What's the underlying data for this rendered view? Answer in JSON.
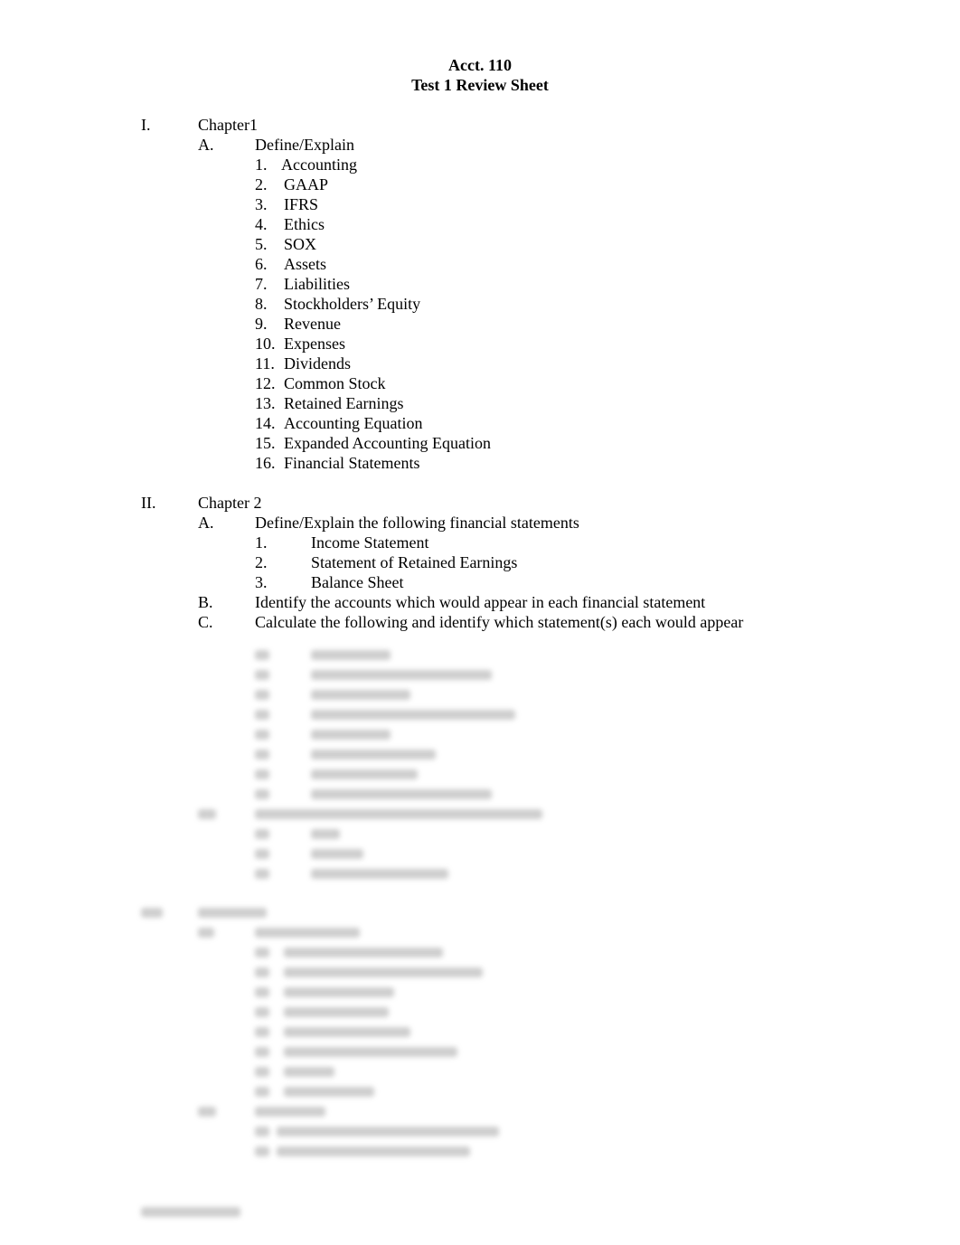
{
  "header": {
    "course": "Acct. 110",
    "title": "Test 1 Review Sheet"
  },
  "sections": [
    {
      "numeral": "I.",
      "heading": "Chapter1",
      "subsections": [
        {
          "letter": "A.",
          "text": "Define/Explain",
          "items": [
            "Accounting",
            "GAAP",
            "IFRS",
            "Ethics",
            "SOX",
            "Assets",
            "Liabilities",
            "Stockholders’ Equity",
            "Revenue",
            "Expenses",
            "Dividends",
            "Common Stock",
            "Retained Earnings",
            "Accounting Equation",
            "Expanded Accounting Equation",
            "Financial Statements"
          ]
        }
      ]
    },
    {
      "numeral": "II.",
      "heading": "Chapter 2",
      "subsections": [
        {
          "letter": "A.",
          "text": "Define/Explain the following financial statements",
          "items": [
            "Income Statement",
            "Statement of Retained Earnings",
            "Balance Sheet"
          ]
        },
        {
          "letter": "B.",
          "text": "Identify the accounts which would appear in each financial statement",
          "items": []
        },
        {
          "letter": "C.",
          "text": "Calculate the following and identify which statement(s) each would appear",
          "items": []
        }
      ]
    }
  ],
  "blurred_content": true,
  "colors": {
    "text": "#000000",
    "blurred": "#bdbdbd"
  }
}
